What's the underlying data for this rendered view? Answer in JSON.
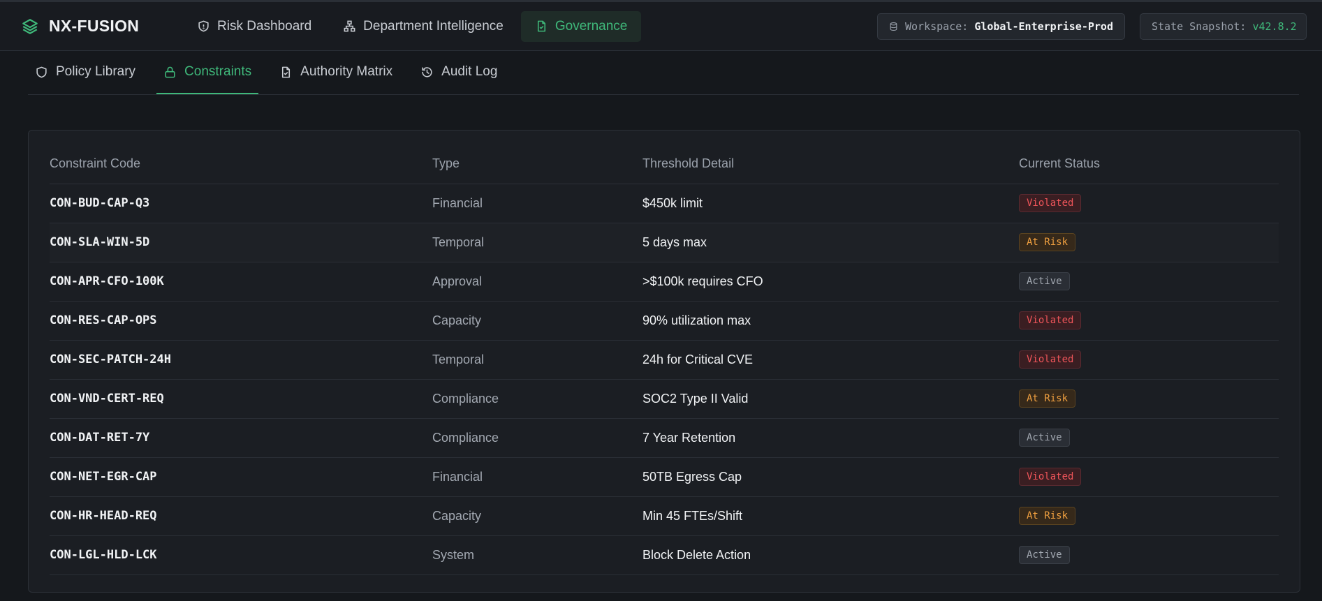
{
  "app": {
    "name": "NX-FUSION",
    "logo_icon": "layers-icon"
  },
  "nav": [
    {
      "label": "Risk Dashboard",
      "icon": "shield-icon",
      "active": false
    },
    {
      "label": "Department Intelligence",
      "icon": "org-chart-icon",
      "active": false
    },
    {
      "label": "Governance",
      "icon": "file-check-icon",
      "active": true
    }
  ],
  "workspace": {
    "label": "Workspace:",
    "value": "Global-Enterprise-Prod"
  },
  "snapshot": {
    "label": "State Snapshot:",
    "value": "v42.8.2"
  },
  "subtabs": [
    {
      "label": "Policy Library",
      "icon": "shield-icon",
      "active": false
    },
    {
      "label": "Constraints",
      "icon": "lock-icon",
      "active": true
    },
    {
      "label": "Authority Matrix",
      "icon": "file-check-icon",
      "active": false
    },
    {
      "label": "Audit Log",
      "icon": "history-icon",
      "active": false
    }
  ],
  "table": {
    "headers": [
      "Constraint Code",
      "Type",
      "Threshold Detail",
      "Current Status"
    ],
    "rows": [
      {
        "code": "CON-BUD-CAP-Q3",
        "type": "Financial",
        "threshold": "$450k limit",
        "status": "Violated"
      },
      {
        "code": "CON-SLA-WIN-5D",
        "type": "Temporal",
        "threshold": "5 days max",
        "status": "At Risk"
      },
      {
        "code": "CON-APR-CFO-100K",
        "type": "Approval",
        "threshold": ">$100k requires CFO",
        "status": "Active"
      },
      {
        "code": "CON-RES-CAP-OPS",
        "type": "Capacity",
        "threshold": "90% utilization max",
        "status": "Violated"
      },
      {
        "code": "CON-SEC-PATCH-24H",
        "type": "Temporal",
        "threshold": "24h for Critical CVE",
        "status": "Violated"
      },
      {
        "code": "CON-VND-CERT-REQ",
        "type": "Compliance",
        "threshold": "SOC2 Type II Valid",
        "status": "At Risk"
      },
      {
        "code": "CON-DAT-RET-7Y",
        "type": "Compliance",
        "threshold": "7 Year Retention",
        "status": "Active"
      },
      {
        "code": "CON-NET-EGR-CAP",
        "type": "Financial",
        "threshold": "50TB Egress Cap",
        "status": "Violated"
      },
      {
        "code": "CON-HR-HEAD-REQ",
        "type": "Capacity",
        "threshold": "Min 45 FTEs/Shift",
        "status": "At Risk"
      },
      {
        "code": "CON-LGL-HLD-LCK",
        "type": "System",
        "threshold": "Block Delete Action",
        "status": "Active"
      }
    ]
  },
  "colors": {
    "accent": "#3fb87a",
    "violated": "#f0555a",
    "at_risk": "#f0a040",
    "active": "#a3a9b2"
  }
}
